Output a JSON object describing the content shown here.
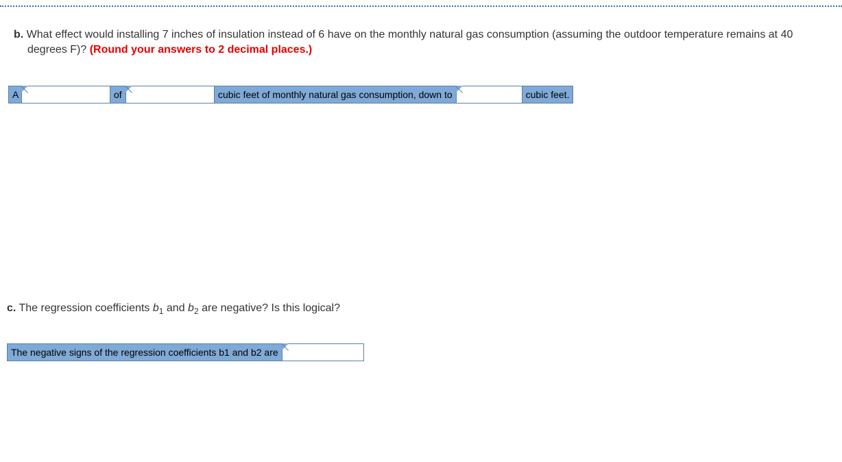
{
  "question_b": {
    "label": "b.",
    "text": "What effect would installing 7 inches of insulation instead of 6 have on the monthly natural gas consumption (assuming the outdoor temperature remains at 40 degrees F)? ",
    "instruction": "(Round your answers to 2 decimal places.)"
  },
  "answer_b": {
    "cell_a": "A",
    "input1": "",
    "cell_of": "of",
    "input2": "",
    "cell_text1": "cubic feet of monthly natural gas consumption, down to",
    "input3": "",
    "cell_text2": "cubic feet."
  },
  "question_c": {
    "label": "c.",
    "text_pre": "The regression coefficients ",
    "b1": "b",
    "sub1": "1",
    "and": " and ",
    "b2": "b",
    "sub2": "2",
    "text_post": " are negative? Is this logical?"
  },
  "answer_c": {
    "cell_text": "The negative signs of the regression coefficients b1 and b2 are",
    "input": ""
  }
}
